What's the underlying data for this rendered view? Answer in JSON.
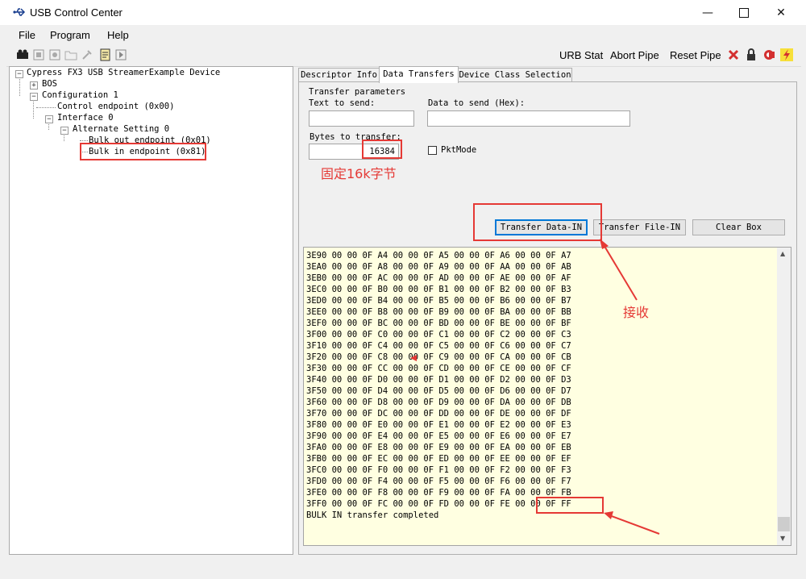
{
  "window": {
    "title": "USB Control Center"
  },
  "menu": {
    "items": [
      "File",
      "Program",
      "Help"
    ]
  },
  "toolbar": {
    "urb_stat": "URB Stat",
    "abort_pipe": "Abort Pipe",
    "reset_pipe": "Reset Pipe"
  },
  "tree": {
    "device": "Cypress FX3 USB StreamerExample Device",
    "bos": "BOS",
    "config": "Configuration 1",
    "control_ep": "Control endpoint (0x00)",
    "interface": "Interface 0",
    "alt_setting": "Alternate Setting 0",
    "bulk_out": "Bulk out endpoint (0x01)",
    "bulk_in": "Bulk in endpoint (0x81)"
  },
  "tabs": [
    "Descriptor Info",
    "Data Transfers",
    "Device Class Selection"
  ],
  "transfer": {
    "params_label": "Transfer parameters",
    "text_label": "Text to send:",
    "hex_label": "Data to send (Hex):",
    "bytes_label": "Bytes to transfer:",
    "bytes_value": "16384",
    "pktmode_label": "PktMode",
    "btn_transfer_data": "Transfer Data-IN",
    "btn_transfer_file": "Transfer File-IN",
    "btn_clear": "Clear Box"
  },
  "output": {
    "lines": [
      "3E90 00 00 0F A4 00 00 0F A5 00 00 0F A6 00 00 0F A7",
      "3EA0 00 00 0F A8 00 00 0F A9 00 00 0F AA 00 00 0F AB",
      "3EB0 00 00 0F AC 00 00 0F AD 00 00 0F AE 00 00 0F AF",
      "3EC0 00 00 0F B0 00 00 0F B1 00 00 0F B2 00 00 0F B3",
      "3ED0 00 00 0F B4 00 00 0F B5 00 00 0F B6 00 00 0F B7",
      "3EE0 00 00 0F B8 00 00 0F B9 00 00 0F BA 00 00 0F BB",
      "3EF0 00 00 0F BC 00 00 0F BD 00 00 0F BE 00 00 0F BF",
      "3F00 00 00 0F C0 00 00 0F C1 00 00 0F C2 00 00 0F C3",
      "3F10 00 00 0F C4 00 00 0F C5 00 00 0F C6 00 00 0F C7",
      "3F20 00 00 0F C8 00 00 0F C9 00 00 0F CA 00 00 0F CB",
      "3F30 00 00 0F CC 00 00 0F CD 00 00 0F CE 00 00 0F CF",
      "3F40 00 00 0F D0 00 00 0F D1 00 00 0F D2 00 00 0F D3",
      "3F50 00 00 0F D4 00 00 0F D5 00 00 0F D6 00 00 0F D7",
      "3F60 00 00 0F D8 00 00 0F D9 00 00 0F DA 00 00 0F DB",
      "3F70 00 00 0F DC 00 00 0F DD 00 00 0F DE 00 00 0F DF",
      "3F80 00 00 0F E0 00 00 0F E1 00 00 0F E2 00 00 0F E3",
      "3F90 00 00 0F E4 00 00 0F E5 00 00 0F E6 00 00 0F E7",
      "3FA0 00 00 0F E8 00 00 0F E9 00 00 0F EA 00 00 0F EB",
      "3FB0 00 00 0F EC 00 00 0F ED 00 00 0F EE 00 00 0F EF",
      "3FC0 00 00 0F F0 00 00 0F F1 00 00 0F F2 00 00 0F F3",
      "3FD0 00 00 0F F4 00 00 0F F5 00 00 0F F6 00 00 0F F7",
      "3FE0 00 00 0F F8 00 00 0F F9 00 00 0F FA 00 00 0F FB",
      "3FF0 00 00 0F FC 00 00 0F FD 00 00 0F FE 00 00 0F FF",
      "BULK IN transfer completed"
    ]
  },
  "annotations": {
    "fixed_size": "固定16k字节",
    "receive": "接收"
  },
  "colors": {
    "annotation": "#e53935",
    "output_bg": "#ffffe1",
    "focus": "#0078d7"
  }
}
